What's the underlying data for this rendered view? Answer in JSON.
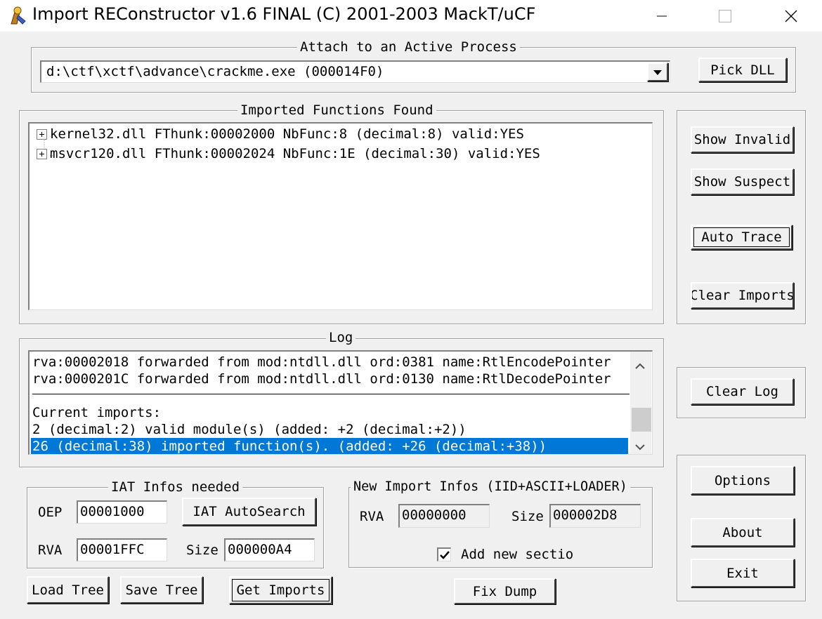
{
  "window": {
    "title": "Import REConstructor v1.6 FINAL (C) 2001-2003 MackT/uCF"
  },
  "attach": {
    "legend": "Attach to an Active Process",
    "process_value": "d:\\ctf\\xctf\\advance\\crackme.exe (000014F0)",
    "pick_dll_label": "Pick DLL"
  },
  "imported": {
    "legend": "Imported Functions Found",
    "items": [
      "kernel32.dll FThunk:00002000 NbFunc:8 (decimal:8) valid:YES",
      "msvcr120.dll FThunk:00002024 NbFunc:1E (decimal:30) valid:YES"
    ]
  },
  "side_top": {
    "show_invalid": "Show Invalid",
    "show_suspect": "Show Suspect",
    "auto_trace": "Auto Trace",
    "clear_imports": "Clear Imports"
  },
  "log": {
    "legend": "Log",
    "lines": [
      "rva:00002018 forwarded from mod:ntdll.dll ord:0381 name:RtlEncodePointer",
      "rva:0000201C forwarded from mod:ntdll.dll ord:0130 name:RtlDecodePointer",
      "Current imports:",
      "2 (decimal:2) valid module(s) (added: +2 (decimal:+2))",
      "26 (decimal:38) imported function(s). (added: +26 (decimal:+38))"
    ],
    "clear_log": "Clear Log"
  },
  "iat": {
    "legend": "IAT Infos needed",
    "oep_label": "OEP",
    "oep_value": "00001000",
    "autosearch": "IAT AutoSearch",
    "rva_label": "RVA",
    "rva_value": "00001FFC",
    "size_label": "Size",
    "size_value": "000000A4"
  },
  "new_import": {
    "legend": "New Import Infos (IID+ASCII+LOADER)",
    "rva_label": "RVA",
    "rva_value": "00000000",
    "size_label": "Size",
    "size_value": "000002D8",
    "add_section_label": "Add new sectio",
    "add_section_checked": true
  },
  "bottom": {
    "load_tree": "Load Tree",
    "save_tree": "Save Tree",
    "get_imports": "Get Imports",
    "fix_dump": "Fix Dump"
  },
  "side_bottom": {
    "options": "Options",
    "about": "About",
    "exit": "Exit"
  },
  "colors": {
    "selection": "#0078d7",
    "background": "#f0f0f0"
  }
}
